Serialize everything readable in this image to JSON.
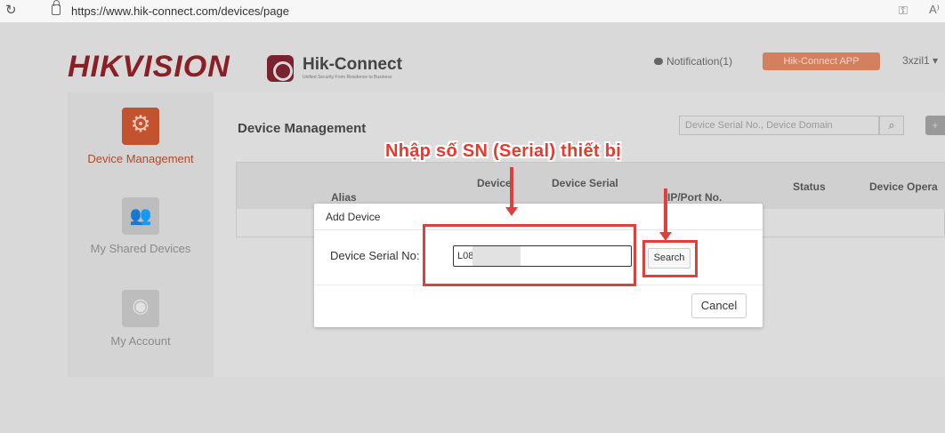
{
  "browser": {
    "url": "https://www.hik-connect.com/devices/page",
    "reload_icon": "reload-icon",
    "lock_icon": "lock-icon"
  },
  "header": {
    "logo": "HIKVISION",
    "app_name": "Hik-Connect",
    "app_tagline": "Unified Security From Residence to Business",
    "notification": "Notification(1)",
    "app_button": "Hik-Connect APP",
    "user": "3xzil1 ▾"
  },
  "sidebar": {
    "items": [
      {
        "label": "Device Management",
        "icon": "gear-icon"
      },
      {
        "label": "My Shared Devices",
        "icon": "shared-users-icon"
      },
      {
        "label": "My Account",
        "icon": "account-icon"
      }
    ]
  },
  "main": {
    "title": "Device Management",
    "search_placeholder": "Device Serial No., Device Domain",
    "columns": [
      "Alias",
      "Device",
      "Device Serial",
      "IP/Port No.",
      "Status",
      "Device Opera"
    ]
  },
  "dialog": {
    "title": "Add Device",
    "serial_label": "Device Serial No:",
    "serial_value": "L08",
    "search_label": "Search",
    "cancel_label": "Cancel"
  },
  "annotation": {
    "text": "Nhập số SN (Serial) thiết bị",
    "color": "#e0403b"
  }
}
